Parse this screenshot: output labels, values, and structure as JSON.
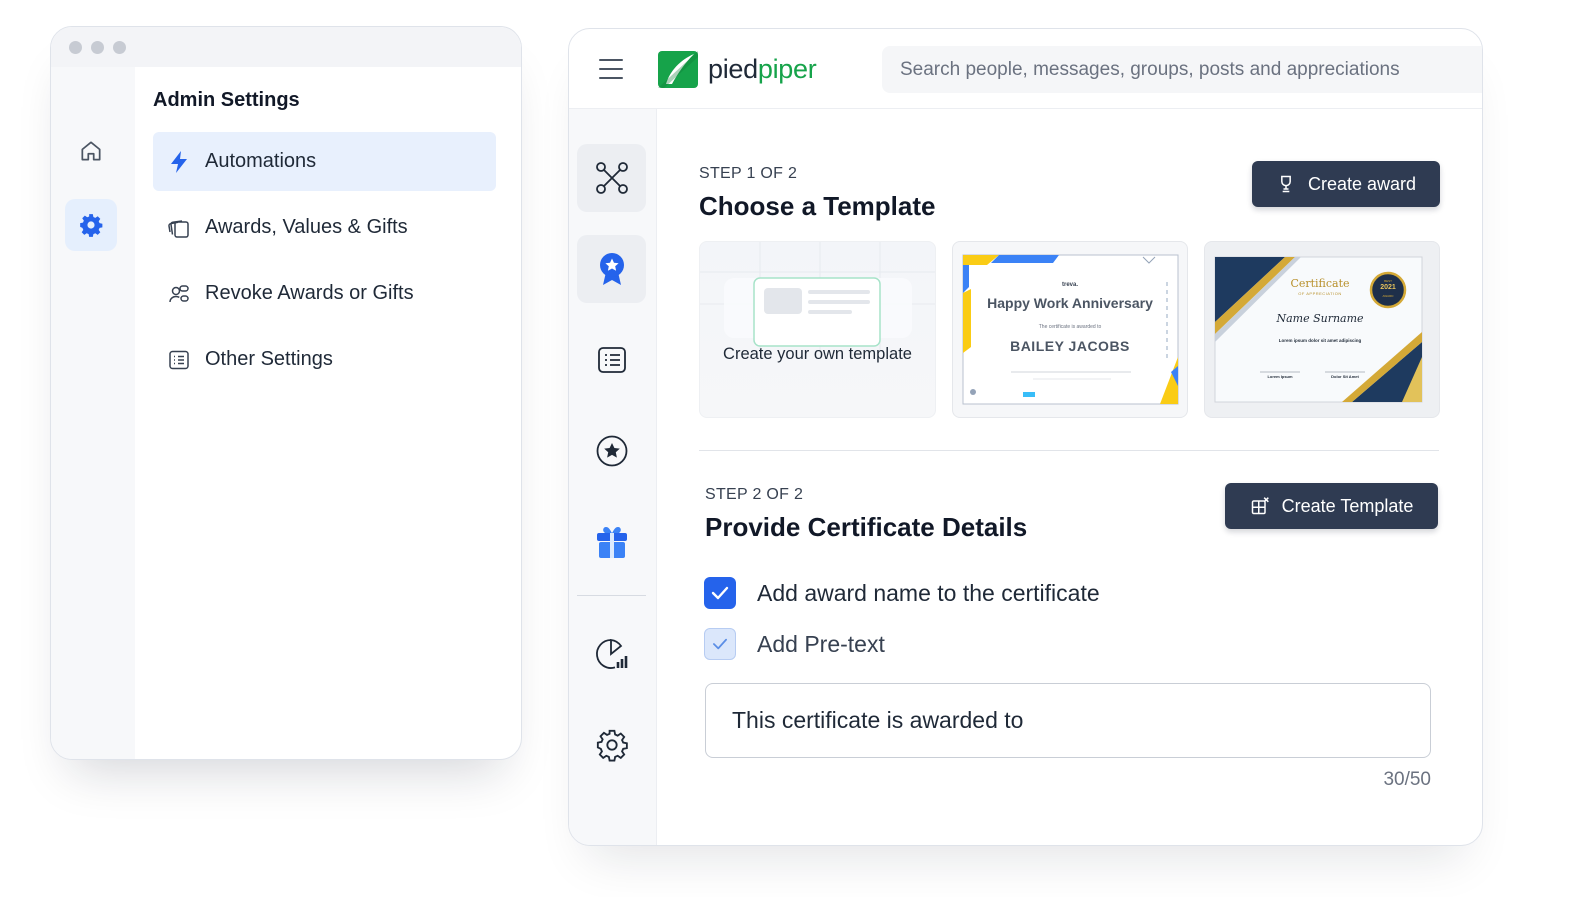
{
  "admin": {
    "title": "Admin Settings",
    "menu": [
      {
        "label": "Automations",
        "icon": "lightning-icon",
        "active": true
      },
      {
        "label": "Awards, Values & Gifts",
        "icon": "stacked-cards-icon",
        "active": false
      },
      {
        "label": "Revoke Awards or Gifts",
        "icon": "users-link-icon",
        "active": false
      },
      {
        "label": "Other Settings",
        "icon": "list-icon",
        "active": false
      }
    ],
    "rail": [
      {
        "icon": "home-icon",
        "active": false
      },
      {
        "icon": "gear-icon",
        "active": true
      }
    ]
  },
  "app": {
    "logo": {
      "part1": "pied",
      "part2": "piper"
    },
    "search_placeholder": "Search people, messages, groups, posts and appreciations",
    "rail": [
      {
        "icon": "network-icon"
      },
      {
        "icon": "award-ribbon-icon"
      },
      {
        "icon": "list-card-icon"
      },
      {
        "icon": "star-circle-icon"
      },
      {
        "icon": "gift-icon"
      },
      {
        "icon": "analytics-icon"
      },
      {
        "icon": "settings-icon"
      }
    ],
    "step1": {
      "label": "STEP 1 OF 2",
      "title": "Choose a Template",
      "button": "Create award",
      "own_template_label": "Create your own template",
      "template2": {
        "brand": "treva.",
        "heading": "Happy Work Anniversary",
        "sub": "The certificate is awarded to",
        "name": "BAILEY JACOBS"
      },
      "template3": {
        "heading": "Certificate",
        "sub": "OF APPRECIATION",
        "name": "Name Surname",
        "line": "Lorem ipsum dolor sit amet adipiscing",
        "seal_top": "BEST",
        "seal_year": "2021",
        "seal_bottom": "AWARD",
        "sign_left": "Lorem Ipsum",
        "sign_right": "Dolor Sit Amet"
      }
    },
    "step2": {
      "label": "STEP 2 OF 2",
      "title": "Provide Certificate Details",
      "button": "Create Template",
      "checks": [
        {
          "label": "Add award name to the certificate",
          "checked": true
        },
        {
          "label": "Add Pre-text",
          "checked": true
        }
      ],
      "pretext_value": "This certificate is awarded to",
      "counter": "30/50"
    },
    "colors": {
      "primary": "#2563eb",
      "dark_button": "#2f3b52",
      "brand_green": "#16a34a"
    }
  }
}
